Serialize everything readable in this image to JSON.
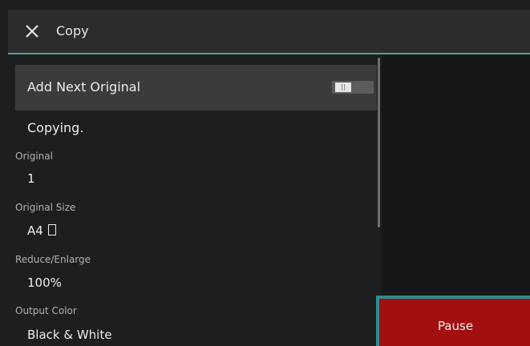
{
  "header": {
    "title": "Copy",
    "close_icon": "close-icon"
  },
  "add_next": {
    "label": "Add Next Original",
    "toggle_state": "off"
  },
  "status": "Copying.",
  "fields": {
    "original": {
      "label": "Original",
      "value": "1"
    },
    "original_size": {
      "label": "Original Size",
      "value": "A4",
      "orientation_icon": "portrait-orientation-icon"
    },
    "reduce_enlarge": {
      "label": "Reduce/Enlarge",
      "value": "100%"
    },
    "output_color": {
      "label": "Output Color",
      "value": "Black & White"
    }
  },
  "actions": {
    "pause_label": "Pause"
  },
  "colors": {
    "accent": "#4aa79c",
    "pause_bg": "#a30f0f",
    "pause_border": "#2f8f8a"
  }
}
